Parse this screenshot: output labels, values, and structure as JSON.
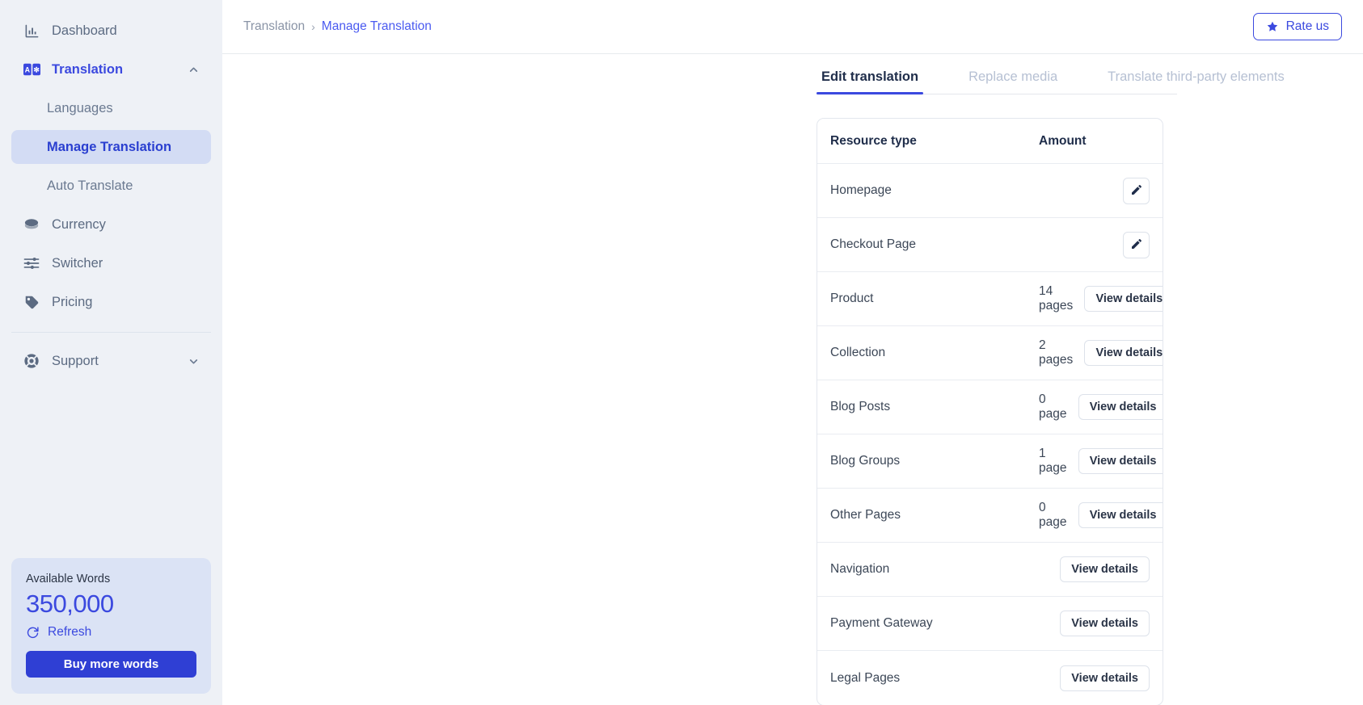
{
  "sidebar": {
    "items": [
      {
        "label": "Dashboard",
        "icon": "chart-bar-icon"
      },
      {
        "label": "Translation",
        "icon": "translate-icon",
        "expanded": true,
        "chevron": "chevron-up-icon"
      },
      {
        "label": "Currency",
        "icon": "coins-icon"
      },
      {
        "label": "Switcher",
        "icon": "sliders-icon"
      },
      {
        "label": "Pricing",
        "icon": "tag-icon"
      },
      {
        "label": "Support",
        "icon": "lifebuoy-icon",
        "chevron": "chevron-down-icon"
      }
    ],
    "sub_items": [
      {
        "label": "Languages",
        "selected": false
      },
      {
        "label": "Manage Translation",
        "selected": true
      },
      {
        "label": "Auto Translate",
        "selected": false
      }
    ],
    "words_card": {
      "title": "Available Words",
      "count": "350,000",
      "refresh_label": "Refresh",
      "refresh_icon": "refresh-icon",
      "buy_label": "Buy more words"
    }
  },
  "topbar": {
    "breadcrumb_root": "Translation",
    "breadcrumb_separator": "›",
    "breadcrumb_current": "Manage Translation",
    "rate_label": "Rate us",
    "rate_icon": "star-icon"
  },
  "tabs": [
    {
      "label": "Edit translation",
      "active": true
    },
    {
      "label": "Replace media",
      "active": false
    },
    {
      "label": "Translate third-party elements",
      "active": false
    }
  ],
  "table": {
    "columns": [
      "Resource type",
      "Amount"
    ],
    "rows": [
      {
        "type": "Homepage",
        "amount": "",
        "action": "edit",
        "action_label": ""
      },
      {
        "type": "Checkout Page",
        "amount": "",
        "action": "edit",
        "action_label": ""
      },
      {
        "type": "Product",
        "amount": "14 pages",
        "action": "view",
        "action_label": "View details"
      },
      {
        "type": "Collection",
        "amount": "2 pages",
        "action": "view",
        "action_label": "View details"
      },
      {
        "type": "Blog Posts",
        "amount": "0 page",
        "action": "view",
        "action_label": "View details"
      },
      {
        "type": "Blog Groups",
        "amount": "1 page",
        "action": "view",
        "action_label": "View details"
      },
      {
        "type": "Other Pages",
        "amount": "0 page",
        "action": "view",
        "action_label": "View details"
      },
      {
        "type": "Navigation",
        "amount": "",
        "action": "view",
        "action_label": "View details"
      },
      {
        "type": "Payment Gateway",
        "amount": "",
        "action": "view",
        "action_label": "View details"
      },
      {
        "type": "Legal Pages",
        "amount": "",
        "action": "view",
        "action_label": "View details"
      }
    ],
    "edit_icon": "pencil-icon"
  },
  "colors": {
    "accent": "#3b49df",
    "sidebar_bg": "#eef1f6",
    "selected_bg": "#d3dcf4",
    "words_card_bg": "#dbe3f5",
    "buy_button": "#2f3fd4",
    "muted_text": "#8a94a6"
  }
}
